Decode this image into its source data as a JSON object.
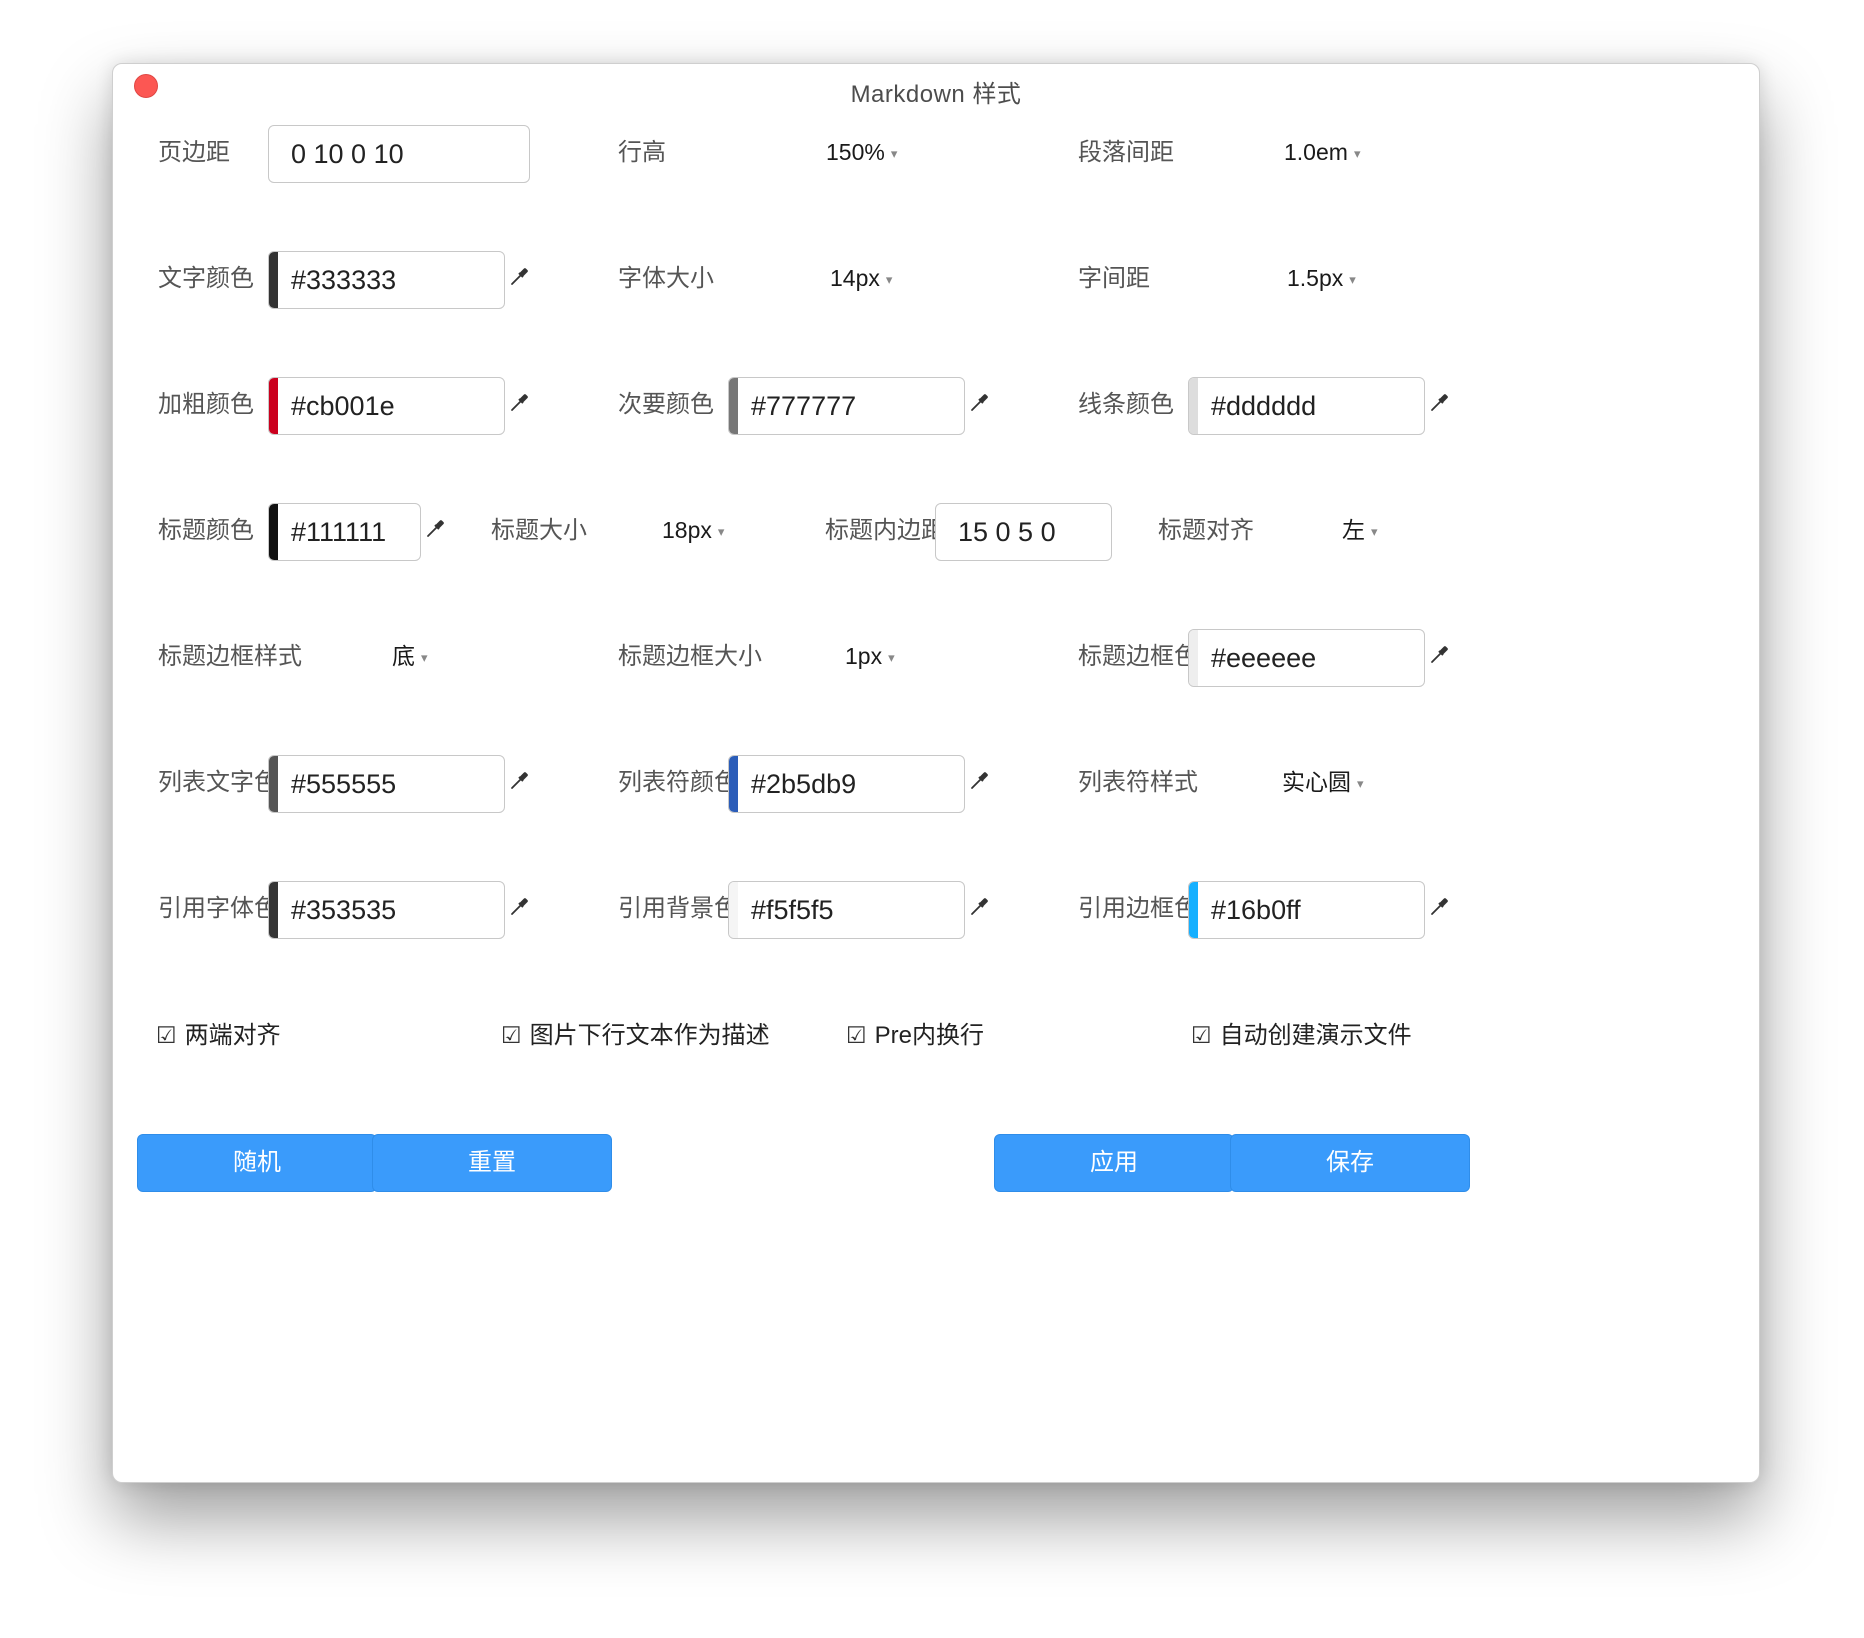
{
  "window": {
    "title": "Markdown 样式"
  },
  "fields": {
    "page_margin": {
      "label": "页边距",
      "value": "0 10 0 10"
    },
    "line_height": {
      "label": "行高",
      "value": "150%"
    },
    "paragraph_spacing": {
      "label": "段落间距",
      "value": "1.0em"
    },
    "text_color": {
      "label": "文字颜色",
      "value": "#333333",
      "color": "#333333"
    },
    "font_size": {
      "label": "字体大小",
      "value": "14px"
    },
    "letter_spacing": {
      "label": "字间距",
      "value": "1.5px"
    },
    "bold_color": {
      "label": "加粗颜色",
      "value": "#cb001e",
      "color": "#cb001e"
    },
    "secondary_color": {
      "label": "次要颜色",
      "value": "#777777",
      "color": "#777777"
    },
    "line_color": {
      "label": "线条颜色",
      "value": "#dddddd",
      "color": "#dddddd"
    },
    "heading_color": {
      "label": "标题颜色",
      "value": "#111111",
      "color": "#111111"
    },
    "heading_size": {
      "label": "标题大小",
      "value": "18px"
    },
    "heading_padding": {
      "label": "标题内边距",
      "value": "15 0 5 0"
    },
    "heading_align": {
      "label": "标题对齐",
      "value": "左"
    },
    "heading_border_style": {
      "label": "标题边框样式",
      "value": "底"
    },
    "heading_border_size": {
      "label": "标题边框大小",
      "value": "1px"
    },
    "heading_border_color": {
      "label": "标题边框色",
      "value": "#eeeeee",
      "color": "#eeeeee"
    },
    "list_text_color": {
      "label": "列表文字色",
      "value": "#555555",
      "color": "#555555"
    },
    "list_marker_color": {
      "label": "列表符颜色",
      "value": "#2b5db9",
      "color": "#2b5db9"
    },
    "list_marker_style": {
      "label": "列表符样式",
      "value": "实心圆"
    },
    "quote_text_color": {
      "label": "引用字体色",
      "value": "#353535",
      "color": "#353535"
    },
    "quote_bg_color": {
      "label": "引用背景色",
      "value": "#f5f5f5",
      "color": "#f5f5f5"
    },
    "quote_border_color": {
      "label": "引用边框色",
      "value": "#16b0ff",
      "color": "#16b0ff"
    }
  },
  "options": {
    "justify": {
      "label": "两端对齐",
      "checked": true,
      "mark": "☑"
    },
    "image_caption": {
      "label": "图片下行文本作为描述",
      "checked": true,
      "mark": "☑"
    },
    "pre_wrap": {
      "label": "Pre内换行",
      "checked": true,
      "mark": "☑"
    },
    "auto_slides": {
      "label": "自动创建演示文件",
      "checked": true,
      "mark": "☑"
    }
  },
  "buttons": {
    "random": "随机",
    "reset": "重置",
    "apply": "应用",
    "save": "保存"
  },
  "icons": {
    "picker": "eyedropper-icon",
    "dropdown": "chevron-down-icon",
    "caret_glyph": "▾"
  }
}
